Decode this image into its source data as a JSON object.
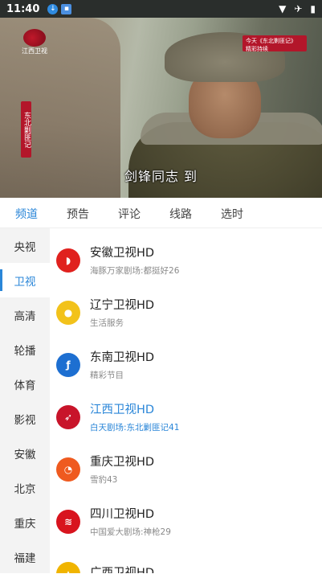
{
  "status_bar": {
    "time": "11:40"
  },
  "video": {
    "logo_text": "江西卫视",
    "side_tag": "东北剿匪记",
    "promo_text": "今天《东北剿匪记》 精彩持续",
    "subtitle": "剑锋同志 到"
  },
  "tabs": [
    {
      "label": "频道",
      "active": true
    },
    {
      "label": "预告",
      "active": false
    },
    {
      "label": "评论",
      "active": false
    },
    {
      "label": "线路",
      "active": false
    },
    {
      "label": "选时",
      "active": false
    }
  ],
  "categories": [
    {
      "label": "央视",
      "active": false
    },
    {
      "label": "卫视",
      "active": true
    },
    {
      "label": "高清",
      "active": false
    },
    {
      "label": "轮播",
      "active": false
    },
    {
      "label": "体育",
      "active": false
    },
    {
      "label": "影视",
      "active": false
    },
    {
      "label": "安徽",
      "active": false
    },
    {
      "label": "北京",
      "active": false
    },
    {
      "label": "重庆",
      "active": false
    },
    {
      "label": "福建",
      "active": false
    }
  ],
  "channels": [
    {
      "name": "安徽卫视HD",
      "program": "海豚万家剧场:都挺好26",
      "icon": "anhui-tv-icon",
      "color": "#e0211e",
      "active": false
    },
    {
      "name": "辽宁卫视HD",
      "program": "生活服务",
      "icon": "liaoning-tv-icon",
      "color": "#f2c21b",
      "active": false
    },
    {
      "name": "东南卫视HD",
      "program": "精彩节目",
      "icon": "dongnan-tv-icon",
      "color": "#1d6fd1",
      "active": false
    },
    {
      "name": "江西卫视HD",
      "program": "白天剧场:东北剿匪记41",
      "icon": "jiangxi-tv-icon",
      "color": "#c8142a",
      "active": true
    },
    {
      "name": "重庆卫视HD",
      "program": "雪豹43",
      "icon": "chongqing-tv-icon",
      "color": "#ef5a1f",
      "active": false
    },
    {
      "name": "四川卫视HD",
      "program": "中国爱大剧场:神枪29",
      "icon": "sichuan-tv-icon",
      "color": "#d8141e",
      "active": false
    },
    {
      "name": "广西卫视HD",
      "program": "",
      "icon": "guangxi-tv-icon",
      "color": "#f0b400",
      "active": false
    }
  ]
}
